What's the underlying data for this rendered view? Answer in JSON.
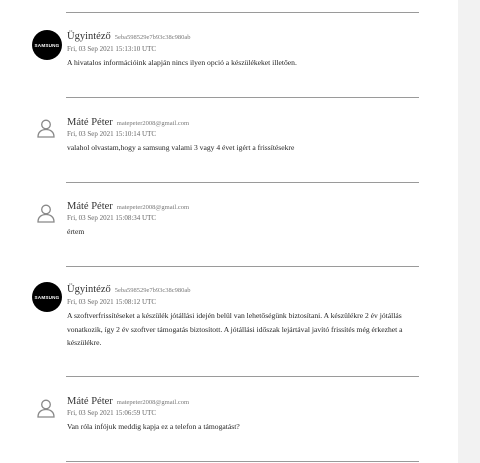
{
  "comments": [
    {
      "author": "Ügyintéző",
      "uid": "5eba598529e7b93c38c980ab",
      "date": "Fri, 03 Sep 2021 15:13:10 UTC",
      "avatar": "SAMSUNG",
      "text": "A hivatalos információink alapján nincs ilyen opció a készülékeket illetően."
    },
    {
      "author": "Máté Péter",
      "uid": "matepeter2008@gmail.com",
      "date": "Fri, 03 Sep 2021 15:10:14 UTC",
      "avatar": "user-icon",
      "text": "valahol olvastam,hogy a samsung valami 3 vagy 4 évet igért a frissítésekre"
    },
    {
      "author": "Máté Péter",
      "uid": "matepeter2008@gmail.com",
      "date": "Fri, 03 Sep 2021 15:08:34 UTC",
      "avatar": "user-icon",
      "text": "értem"
    },
    {
      "author": "Ügyintéző",
      "uid": "5eba598529e7b93c38c980ab",
      "date": "Fri, 03 Sep 2021 15:08:12 UTC",
      "avatar": "SAMSUNG",
      "text": "A szoftverfrissítéseket a készülék jótállási idején belül van lehetőségünk biztosítani. A készülékre 2 év jótállás vonatkozik, így 2 év szoftver támogatás biztosított. A jótállási időszak lejártával javító frissítés még érkezhet a készülékre."
    },
    {
      "author": "Máté Péter",
      "uid": "matepeter2008@gmail.com",
      "date": "Fri, 03 Sep 2021 15:06:59 UTC",
      "avatar": "user-icon",
      "text": "Van róla infójuk meddig kapja ez a telefon a támogatást?"
    }
  ]
}
